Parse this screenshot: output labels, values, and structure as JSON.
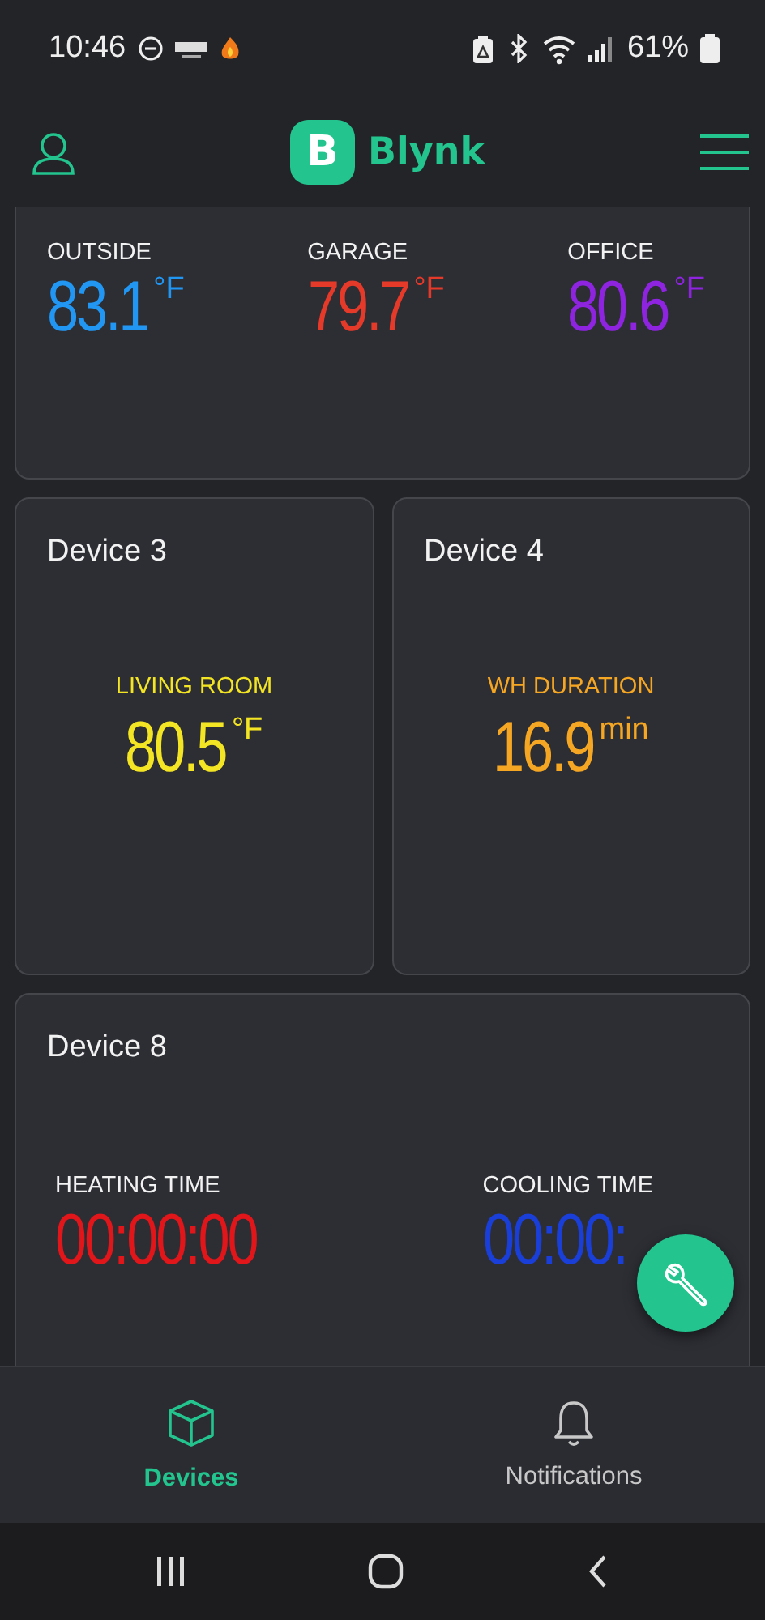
{
  "status_bar": {
    "time": "10:46",
    "battery": "61%"
  },
  "header": {
    "logo_letter": "B",
    "brand": "Blynk"
  },
  "cards": [
    {
      "kind": "row",
      "widgets": [
        {
          "label": "OUTSIDE",
          "value": "83.1",
          "unit": "°F",
          "color": "#2196f3",
          "label_colored": false
        },
        {
          "label": "GARAGE",
          "value": "79.7",
          "unit": "°F",
          "color": "#e5392a",
          "label_colored": false
        },
        {
          "label": "OFFICE",
          "value": "80.6",
          "unit": "°F",
          "color": "#8e24e0",
          "label_colored": false
        }
      ]
    },
    {
      "kind": "center",
      "title": "Device 3",
      "widgets": [
        {
          "label": "LIVING ROOM",
          "value": "80.5",
          "unit": "°F",
          "color": "#f4e524",
          "label_colored": true
        }
      ]
    },
    {
      "kind": "center",
      "title": "Device 4",
      "widgets": [
        {
          "label": "WH DURATION",
          "value": "16.9",
          "unit": "min",
          "color": "#f5a623",
          "label_colored": true
        }
      ]
    },
    {
      "kind": "split",
      "title": "Device 8",
      "widgets": [
        {
          "label": "HEATING TIME",
          "value": "00:00:00",
          "color": "#e0161a",
          "label_colored": false
        },
        {
          "label": "COOLING TIME",
          "value": "00:00:",
          "color": "#1a3fd8",
          "label_colored": false
        }
      ]
    }
  ],
  "bottom_nav": [
    {
      "label": "Devices",
      "selected": true
    },
    {
      "label": "Notifications",
      "selected": false
    }
  ]
}
